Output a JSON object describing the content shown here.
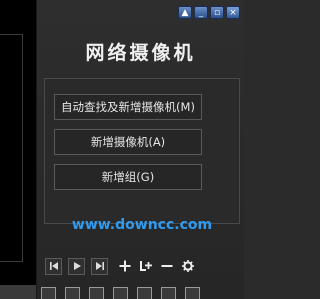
{
  "window": {
    "controls": [
      {
        "icon": "upload-icon",
        "label": "▲"
      },
      {
        "icon": "minimize-icon",
        "label": "_"
      },
      {
        "icon": "restore-icon",
        "label": "▫"
      },
      {
        "icon": "close-icon",
        "label": "×"
      }
    ]
  },
  "panel": {
    "title": "网络摄像机"
  },
  "buttons": {
    "auto_search": "自动查找及新增摄像机(M)",
    "add_camera": "新增摄像机(A)",
    "add_group": "新增组(G)"
  },
  "watermark": "www.downcc.com",
  "playback": {
    "icons": [
      "skip-previous-icon",
      "play-icon",
      "skip-next-icon"
    ],
    "tools": [
      "add-icon",
      "add-to-group-icon",
      "remove-icon",
      "settings-icon"
    ]
  },
  "bottom_toolbar": {
    "icons": [
      "layout-1-icon",
      "layout-2-icon",
      "layout-3-icon",
      "layout-4-icon",
      "layout-5-icon",
      "layout-6-icon",
      "layout-7-icon"
    ]
  }
}
